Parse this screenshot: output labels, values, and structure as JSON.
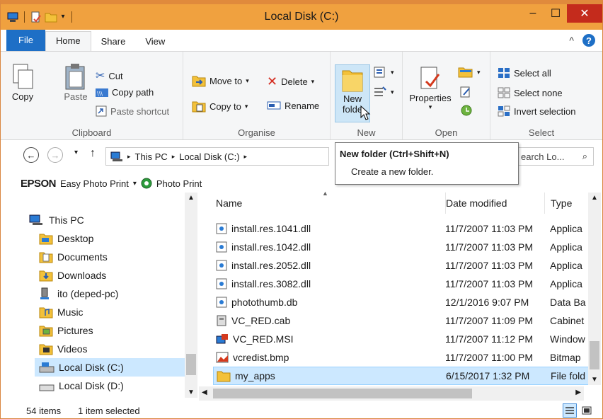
{
  "window": {
    "title": "Local Disk (C:)",
    "accent": "#f0a13f",
    "minimize": "‒",
    "maximize": "☐",
    "close": "✕"
  },
  "tabs": [
    {
      "label": "File"
    },
    {
      "label": "Home"
    },
    {
      "label": "Share"
    },
    {
      "label": "View"
    }
  ],
  "help_label": "?",
  "collapse_ribbon": "^",
  "ribbon": {
    "clipboard": {
      "label": "Clipboard",
      "copy": "Copy",
      "paste": "Paste",
      "cut": "Cut",
      "copy_path": "Copy path",
      "paste_shortcut": "Paste shortcut"
    },
    "organise": {
      "label": "Organise",
      "move_to": "Move to",
      "copy_to": "Copy to",
      "delete": "Delete",
      "rename": "Rename"
    },
    "new": {
      "label": "New",
      "new_folder_line1": "New",
      "new_folder_line2": "folde"
    },
    "open": {
      "label": "Open",
      "properties": "Properties"
    },
    "select": {
      "label": "Select",
      "select_all": "Select all",
      "select_none": "Select none",
      "invert_selection": "Invert selection"
    }
  },
  "tooltip": {
    "title": "New folder (Ctrl+Shift+N)",
    "description": "Create a new folder."
  },
  "address": {
    "crumbs": [
      "This PC",
      "Local Disk (C:)"
    ],
    "search_placeholder": "earch Lo..."
  },
  "epson_bar": {
    "brand": "EPSON",
    "easy_photo_print": "Easy Photo Print",
    "photo_print": "Photo Print"
  },
  "nav_pane": {
    "items": [
      {
        "label": "This PC",
        "icon": "computer-icon"
      },
      {
        "label": "Desktop",
        "icon": "desktop-folder-icon"
      },
      {
        "label": "Documents",
        "icon": "documents-folder-icon"
      },
      {
        "label": "Downloads",
        "icon": "downloads-folder-icon"
      },
      {
        "label": "ito (deped-pc)",
        "icon": "network-user-icon"
      },
      {
        "label": "Music",
        "icon": "music-folder-icon"
      },
      {
        "label": "Pictures",
        "icon": "pictures-folder-icon"
      },
      {
        "label": "Videos",
        "icon": "videos-folder-icon"
      },
      {
        "label": "Local Disk (C:)",
        "icon": "drive-icon"
      },
      {
        "label": "Local Disk (D:)",
        "icon": "drive-icon"
      }
    ],
    "selected_index": 8
  },
  "file_list": {
    "columns": {
      "name": "Name",
      "date": "Date modified",
      "type": "Type"
    },
    "rows": [
      {
        "name": "install.res.1041.dll",
        "date": "11/7/2007 11:03 PM",
        "type": "Applica",
        "icon": "dll-icon"
      },
      {
        "name": "install.res.1042.dll",
        "date": "11/7/2007 11:03 PM",
        "type": "Applica",
        "icon": "dll-icon"
      },
      {
        "name": "install.res.2052.dll",
        "date": "11/7/2007 11:03 PM",
        "type": "Applica",
        "icon": "dll-icon"
      },
      {
        "name": "install.res.3082.dll",
        "date": "11/7/2007 11:03 PM",
        "type": "Applica",
        "icon": "dll-icon"
      },
      {
        "name": "photothumb.db",
        "date": "12/1/2016 9:07 PM",
        "type": "Data Ba",
        "icon": "db-icon"
      },
      {
        "name": "VC_RED.cab",
        "date": "11/7/2007 11:09 PM",
        "type": "Cabinet",
        "icon": "cab-icon"
      },
      {
        "name": "VC_RED.MSI",
        "date": "11/7/2007 11:12 PM",
        "type": "Window",
        "icon": "msi-icon"
      },
      {
        "name": "vcredist.bmp",
        "date": "11/7/2007 11:00 PM",
        "type": "Bitmap",
        "icon": "bmp-icon"
      },
      {
        "name": "my_apps",
        "date": "6/15/2017 1:32 PM",
        "type": "File fold",
        "icon": "folder-icon",
        "selected": true
      }
    ]
  },
  "status": {
    "item_count": "54 items",
    "selection": "1 item selected"
  }
}
